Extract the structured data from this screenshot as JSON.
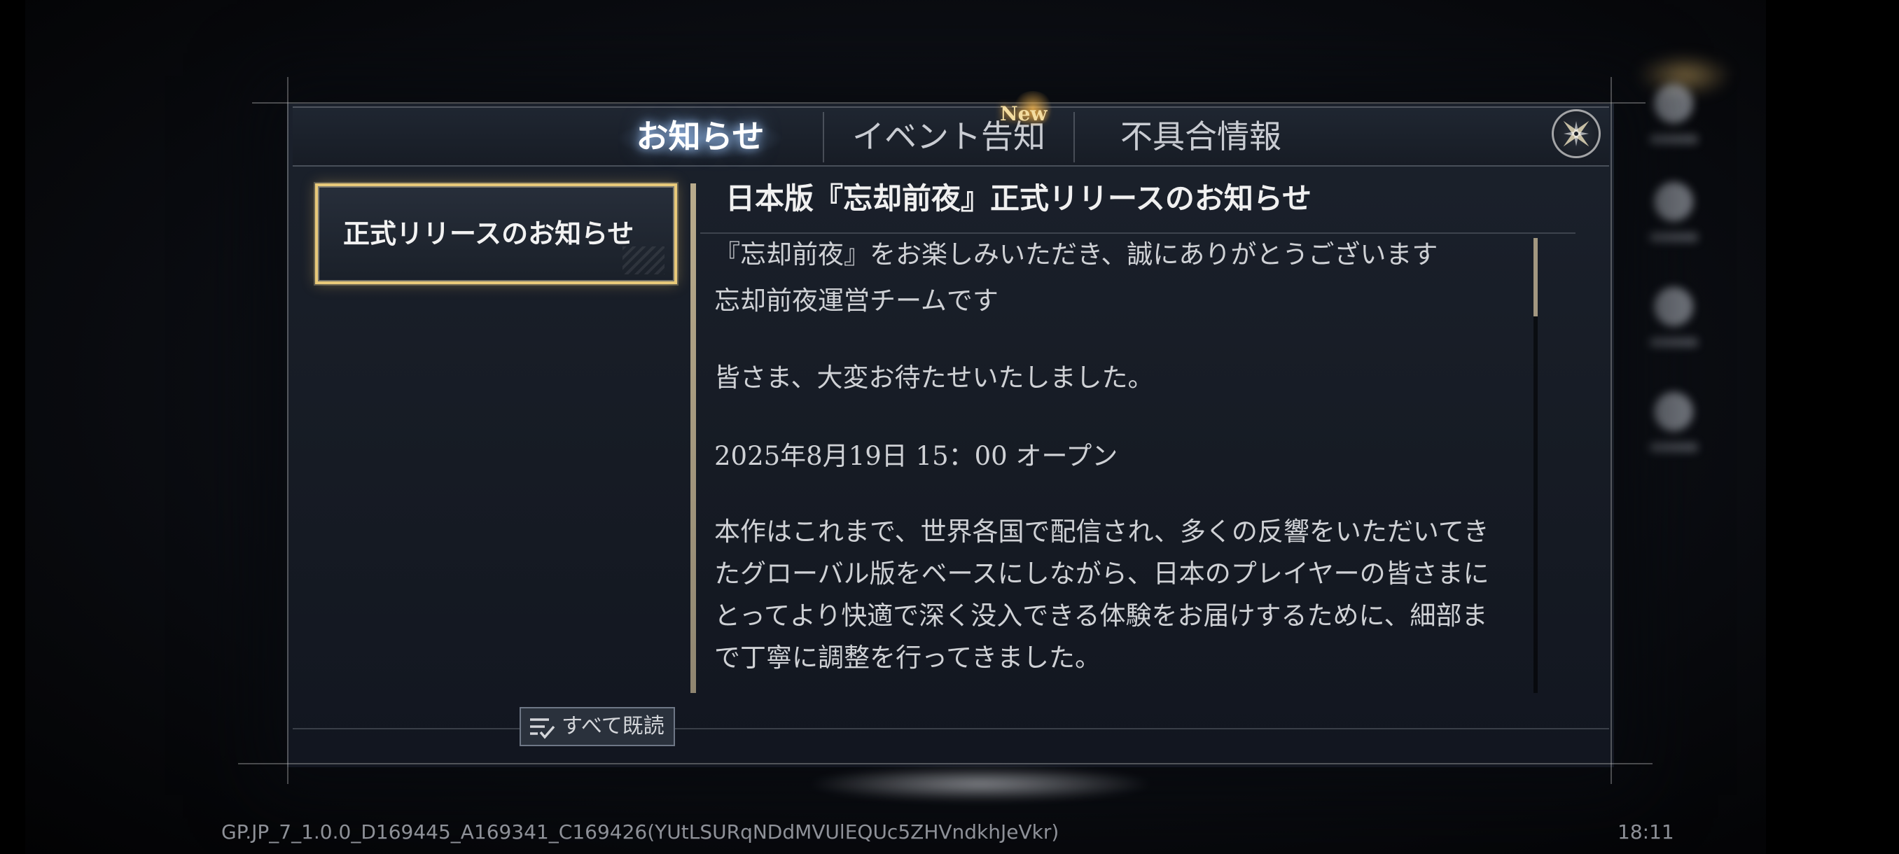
{
  "tabs": [
    {
      "label": "お知らせ",
      "active": true
    },
    {
      "label": "イベント告知",
      "active": false,
      "badge": "New"
    },
    {
      "label": "不具合情報",
      "active": false
    }
  ],
  "close_icon": "compass-close-icon",
  "list": {
    "items": [
      {
        "label": "正式リリースのお知らせ",
        "selected": true
      }
    ]
  },
  "article": {
    "title": "日本版『忘却前夜』正式リリースのお知らせ",
    "lines": [
      "『忘却前夜』をお楽しみいただき、誠にありがとうございます",
      "忘却前夜運営チームです",
      "皆さま、大変お待たせいたしました。",
      "2025年8月19日 15：00 オープン",
      "本作はこれまで、世界各国で配信され、多くの反響をいただいてき",
      "たグローバル版をベースにしながら、日本のプレイヤーの皆さまに",
      "とってより快適で深く没入できる体験をお届けするために、細部ま",
      "で丁寧に調整を行ってきました。"
    ]
  },
  "read_all": {
    "label": "すべて既読",
    "icon": "read-all-icon"
  },
  "footer": {
    "version": "GP.JP_7_1.0.0_D169445_A169341_C169426(YUtLSURqNDdMVUlEQUc5ZHVndkhJeVkr)",
    "time": "18:11"
  },
  "colors": {
    "accent_gold": "#e8c97a",
    "badge_gold": "#f3dca0",
    "panel_bg": "#1b212c"
  }
}
